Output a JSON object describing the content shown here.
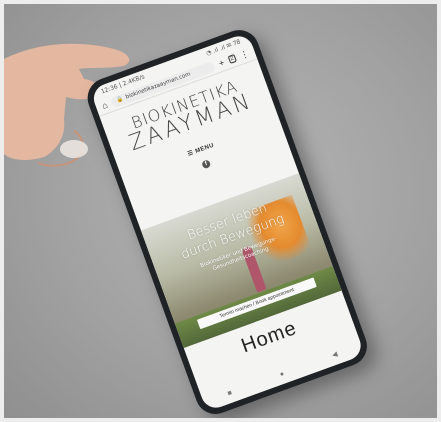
{
  "status": {
    "time": "12:36 | 2.4KB/s",
    "signals": "◔ .ıl .ıl ✉ 78"
  },
  "browser": {
    "url": "biokinetikazaayman.com",
    "new_tab": "+",
    "tabs_count": "2",
    "menu": "⋮"
  },
  "site": {
    "logo_line1": "BIOKINETIKA",
    "logo_line2": "ZAAYMAN",
    "menu_label": "MENU",
    "hero_title_1": "Besser leben",
    "hero_title_2": "durch Bewegung",
    "hero_sub_1": "Biokinetiker und Bewegungs-",
    "hero_sub_2": "Gesundheitscoaching",
    "cta_label": "Termin machen / Book appointment",
    "page_heading": "Home"
  },
  "nav": {
    "left": "■",
    "center": "●",
    "right": "◀"
  }
}
